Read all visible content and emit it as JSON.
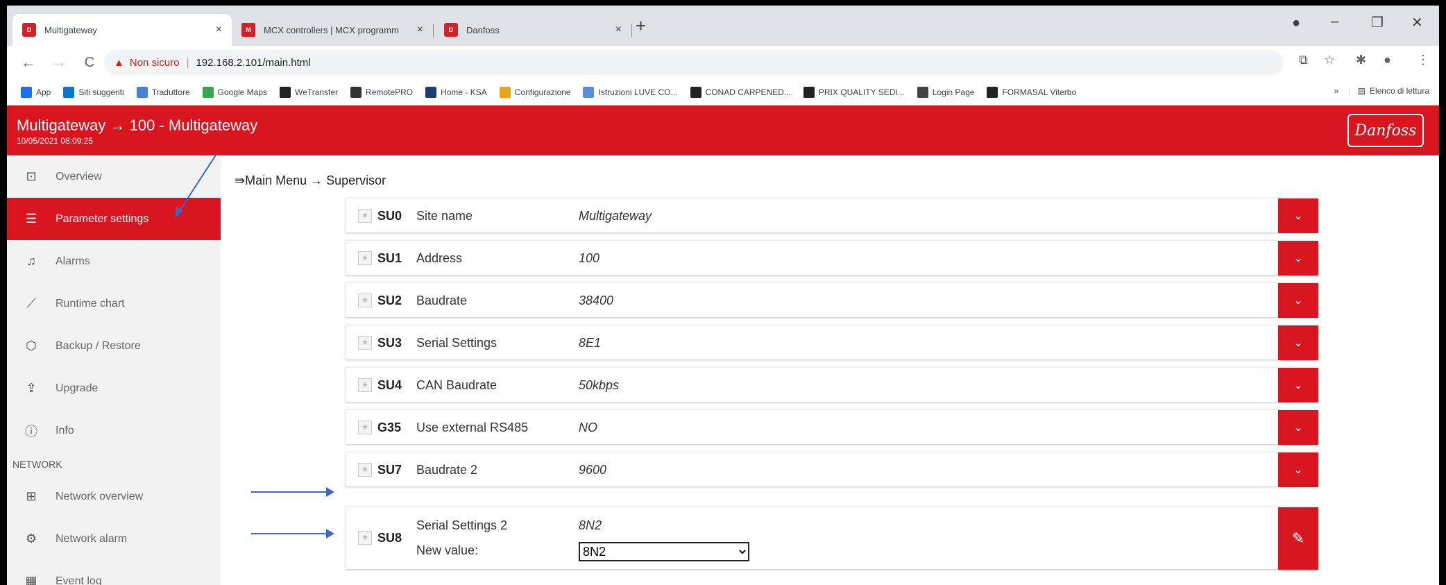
{
  "browser": {
    "tabs": [
      {
        "title": "Multigateway",
        "favicon": "danfoss-favicon"
      },
      {
        "title": "MCX controllers | MCX programm",
        "favicon": "mcx-favicon"
      },
      {
        "title": "Danfoss",
        "favicon": "danfoss-favicon"
      }
    ],
    "new_tab": "+",
    "close_glyph": "×",
    "window_controls": {
      "minimize": "–",
      "restore": "❐",
      "close": "✕"
    },
    "nav": {
      "back": "←",
      "forward": "→",
      "reload": "C"
    },
    "security_warning": "Non sicuro",
    "url": "192.168.2.101/main.html",
    "bookmarks": [
      {
        "label": "App",
        "icon": "apps-grid-icon",
        "color": "#1a73e8"
      },
      {
        "label": "Siti suggeriti",
        "icon": "bing-icon",
        "color": "#0078d4"
      },
      {
        "label": "Traduttore",
        "icon": "translator-icon",
        "color": "#4a7fd8"
      },
      {
        "label": "Google Maps",
        "icon": "maps-pin-icon",
        "color": "#34a853"
      },
      {
        "label": "WeTransfer",
        "icon": "wetransfer-icon",
        "color": "#222222"
      },
      {
        "label": "RemotePRO",
        "icon": "remotepro-icon",
        "color": "#333333"
      },
      {
        "label": "Home - KSA",
        "icon": "ksa-icon",
        "color": "#1b3d7a"
      },
      {
        "label": "Configurazione",
        "icon": "config-icon",
        "color": "#e8a317"
      },
      {
        "label": "Istruzioni LUVE CO...",
        "icon": "globe-icon",
        "color": "#5a8fd8"
      },
      {
        "label": "CONAD CARPENED...",
        "icon": "tb-icon",
        "color": "#222222"
      },
      {
        "label": "PRIX QUALITY SEDI...",
        "icon": "tb-icon",
        "color": "#222222"
      },
      {
        "label": "Login Page",
        "icon": "login-icon",
        "color": "#444444"
      },
      {
        "label": "FORMASAL Viterbo",
        "icon": "tb-icon",
        "color": "#222222"
      }
    ],
    "bookmarks_overflow": "»",
    "reading_list": "Elenco di lettura"
  },
  "app": {
    "title": "Multigateway → 100 - Multigateway",
    "datetime": "10/05/2021 08:09:25",
    "logo_text": "Danfoss",
    "accent": "#d9161f"
  },
  "sidebar": {
    "items": [
      {
        "label": "Overview",
        "icon": "star-box-icon"
      },
      {
        "label": "Parameter settings",
        "icon": "list-icon",
        "active": true
      },
      {
        "label": "Alarms",
        "icon": "bell-icon"
      },
      {
        "label": "Runtime chart",
        "icon": "chart-line-icon"
      },
      {
        "label": "Backup / Restore",
        "icon": "cube-icon"
      },
      {
        "label": "Upgrade",
        "icon": "upload-house-icon"
      },
      {
        "label": "Info",
        "icon": "info-icon"
      }
    ],
    "section": "NETWORK",
    "network_items": [
      {
        "label": "Network overview",
        "icon": "network-icon"
      },
      {
        "label": "Network alarm",
        "icon": "alarm-gear-icon"
      },
      {
        "label": "Event log",
        "icon": "calendar-icon"
      }
    ]
  },
  "breadcrumb": "⇛Main Menu → Supervisor",
  "parameters": [
    {
      "code": "SU0",
      "name": "Site name",
      "value": "Multigateway"
    },
    {
      "code": "SU1",
      "name": "Address",
      "value": "100"
    },
    {
      "code": "SU2",
      "name": "Baudrate",
      "value": "38400"
    },
    {
      "code": "SU3",
      "name": "Serial Settings",
      "value": "8E1"
    },
    {
      "code": "SU4",
      "name": "CAN Baudrate",
      "value": "50kbps"
    },
    {
      "code": "G35",
      "name": "Use external RS485",
      "value": "NO"
    },
    {
      "code": "SU7",
      "name": "Baudrate 2",
      "value": "9600"
    }
  ],
  "editing": {
    "code": "SU8",
    "name": "Serial Settings 2",
    "value": "8N2",
    "new_value_label": "New value:",
    "selected": "8N2"
  },
  "glyphs": {
    "star": "★",
    "chevron": "⌄",
    "pencil": "✎"
  }
}
